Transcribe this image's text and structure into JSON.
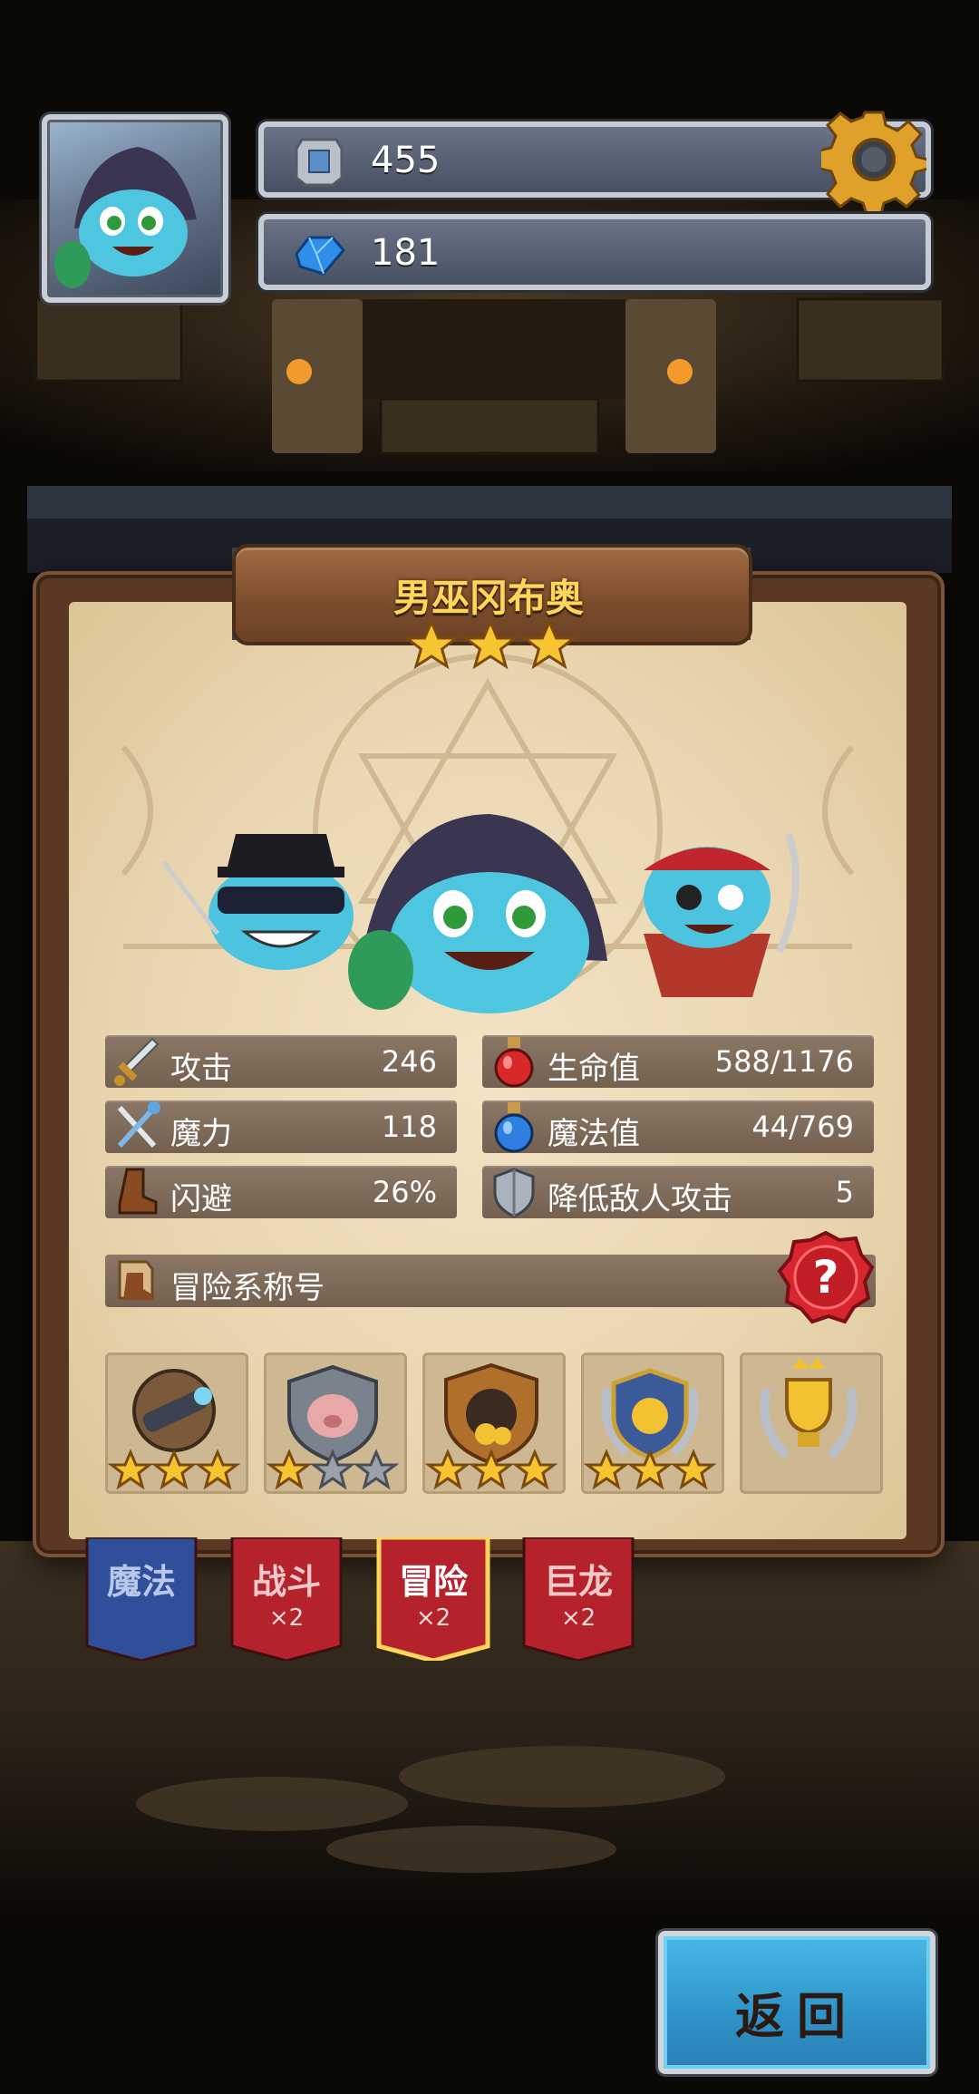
{
  "hud": {
    "resource_primary": "455",
    "resource_gems": "181"
  },
  "hero": {
    "name": "男巫冈布奥",
    "star_rating": 3
  },
  "stats": {
    "attack_label": "攻击",
    "attack_value": "246",
    "magic_label": "魔力",
    "magic_value": "118",
    "dodge_label": "闪避",
    "dodge_value": "26%",
    "hp_label": "生命值",
    "hp_value": "588/1176",
    "mp_label": "魔法值",
    "mp_value": "44/769",
    "def_label": "降低敌人攻击",
    "def_value": "5"
  },
  "title_section": {
    "label": "冒险系称号"
  },
  "badges": [
    {
      "icon": "spyglass-icon",
      "stars": 3
    },
    {
      "icon": "pig-shield-icon",
      "stars": 1
    },
    {
      "icon": "treasure-shield-icon",
      "stars": 3
    },
    {
      "icon": "gold-laurel-icon",
      "stars": 3
    },
    {
      "icon": "trophy-icon",
      "stars": 0
    }
  ],
  "tabs": [
    {
      "label": "魔法",
      "mult": ""
    },
    {
      "label": "战斗",
      "mult": "×2"
    },
    {
      "label": "冒险",
      "mult": "×2"
    },
    {
      "label": "巨龙",
      "mult": "×2"
    }
  ],
  "back_label": "返回",
  "colors": {
    "gold": "#ffd65a",
    "tab_blue": "#2f4f9a",
    "tab_red": "#b5222c",
    "button_blue": "#2f93c9"
  }
}
